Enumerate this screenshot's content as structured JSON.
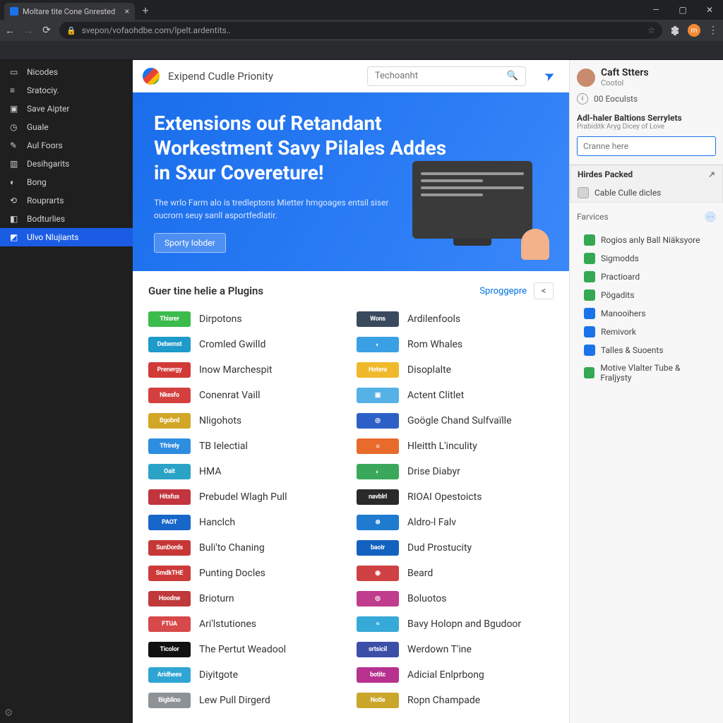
{
  "window": {
    "tab_title": "Moltare tite Cone Gnrested"
  },
  "address": {
    "url": "svepon/vofaohdbe.com/lpelt.ardentits.."
  },
  "leftnav": {
    "items": [
      {
        "label": "Nicodes"
      },
      {
        "label": "Sratociy."
      },
      {
        "label": "Save Aipter"
      },
      {
        "label": "Guale"
      },
      {
        "label": "Aul Foors"
      },
      {
        "label": "Desihgarits"
      },
      {
        "label": "Bong"
      },
      {
        "label": "Rouprarts"
      },
      {
        "label": "Bodturlies"
      },
      {
        "label": "Ulvo Nlujiants"
      }
    ],
    "active_index": 9
  },
  "store": {
    "title": "Exipend Cudle Prionity",
    "search_placeholder": "Techoanht"
  },
  "hero": {
    "headline": "Extensions ouf Retandant Workestment Savy Pilales Addes in Sxur Covereture!",
    "sub": "The wrlo Farm alo is tredleptons Mietter hmgoages entsil siser oucrorn seuy sanll asportfedlatir.",
    "cta": "Sporty Iobder"
  },
  "section": {
    "title": "Guer tine helie a Plugins",
    "more": "Sproggepre"
  },
  "plugins_left": [
    {
      "badge": "Thisrer",
      "color": "#3bbb4c",
      "name": "Dirpotons"
    },
    {
      "badge": "Debemst",
      "color": "#1e9acb",
      "name": "Cromled Gwilld"
    },
    {
      "badge": "Prenergy",
      "color": "#d23a37",
      "name": "Inow Marchespit"
    },
    {
      "badge": "Nkesfo",
      "color": "#d44040",
      "name": "Conenrat Vaill"
    },
    {
      "badge": "Bgobrd",
      "color": "#d2a627",
      "name": "Nligohots"
    },
    {
      "badge": "Tfrirely",
      "color": "#2d8de0",
      "name": "TB Ielectial"
    },
    {
      "badge": "Oait",
      "color": "#2aa3c7",
      "name": "HMA"
    },
    {
      "badge": "Hitsfus",
      "color": "#c2343e",
      "name": "Prebudel Wlagh Pull"
    },
    {
      "badge": "PAOT",
      "color": "#1766c9",
      "name": "Hanclch"
    },
    {
      "badge": "SunDords",
      "color": "#c63838",
      "name": "Buli'to Chaning"
    },
    {
      "badge": "SmdkTHE",
      "color": "#ce3a3a",
      "name": "Punting Docles"
    },
    {
      "badge": "Hoodne",
      "color": "#c0393b",
      "name": "Brioturn"
    },
    {
      "badge": "FTUA",
      "color": "#d7494b",
      "name": "Ari'lstutiones"
    },
    {
      "badge": "Ticolor",
      "color": "#111111",
      "name": "The Pertut Weadool"
    },
    {
      "badge": "Aridhees",
      "color": "#2fa5d4",
      "name": "Diyitgote"
    },
    {
      "badge": "Bigblino",
      "color": "#8d9296",
      "name": "Lew Pull Dirgerd"
    }
  ],
  "plugins_right": [
    {
      "badge": "Wons",
      "color": "#3a4a5e",
      "name": "Ardilenfools"
    },
    {
      "badge": "◐",
      "color": "#3aa0e6",
      "name": "Rom Whales"
    },
    {
      "badge": "Hotera",
      "color": "#f0b92c",
      "name": "Disoplalte"
    },
    {
      "badge": "▣",
      "color": "#55b1e6",
      "name": "Actent Clitlet"
    },
    {
      "badge": "◎",
      "color": "#2d60c7",
      "name": "Goögle Chand Sulfvaïlle"
    },
    {
      "badge": "≡",
      "color": "#e86b2c",
      "name": "Hleitth L'inculity"
    },
    {
      "badge": "◐",
      "color": "#3aa85a",
      "name": "Drise Diabyr"
    },
    {
      "badge": "navblrl",
      "color": "#2a2a2a",
      "name": "RIOAI Opestoicts"
    },
    {
      "badge": "⊕",
      "color": "#1e7bcf",
      "name": "Aldro-l Falv"
    },
    {
      "badge": "baoIr",
      "color": "#1462c0",
      "name": "Dud Prostucity"
    },
    {
      "badge": "◉",
      "color": "#d04143",
      "name": "Beard"
    },
    {
      "badge": "◎",
      "color": "#bf3d8c",
      "name": "Boluotos"
    },
    {
      "badge": "≈",
      "color": "#37a9d8",
      "name": "Bavy Holopn and Bgudoor"
    },
    {
      "badge": "srtsicil",
      "color": "#3b4ea8",
      "name": "Werdown T'ine"
    },
    {
      "badge": "botitc",
      "color": "#b7318f",
      "name": "Adicial Enlprbong"
    },
    {
      "badge": "Notle",
      "color": "#caa62b",
      "name": "Ropn Champade"
    }
  ],
  "right": {
    "user_name": "Caft Stters",
    "user_role": "Cootol",
    "stat": "00 Eoculsts",
    "promo_title": "Adl-haler Baltions Serrylets",
    "promo_sub": "Prabiditk Aryg Dicey of Love",
    "input_placeholder": "Cranne here",
    "packed_title": "Hirdes Packed",
    "packed_item": "Cable Culle dicles",
    "fav_title": "Farvices",
    "fav_items": [
      {
        "label": "Rogios anly Ball Niäksyore",
        "color": "#36a853"
      },
      {
        "label": "Sigmodds",
        "color": "#34a853"
      },
      {
        "label": "Practioard",
        "color": "#34a853"
      },
      {
        "label": "Pögadits",
        "color": "#34a853"
      },
      {
        "label": "Manooihers",
        "color": "#1a73e8"
      },
      {
        "label": "Remivork",
        "color": "#1a73e8"
      },
      {
        "label": "Talles & Suoents",
        "color": "#1a73e8"
      },
      {
        "label": "Motive Vlalter Tube & Fraljysty",
        "color": "#34a853"
      }
    ]
  }
}
